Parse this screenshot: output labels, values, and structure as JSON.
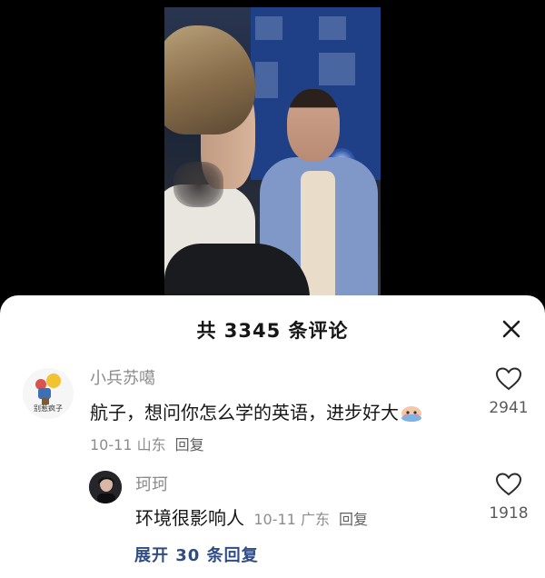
{
  "comments_header": {
    "title": "共 3345 条评论"
  },
  "comments": [
    {
      "username": "小兵苏噶",
      "avatar_caption": "别惹疯子",
      "text": "航子，想问你怎么学的英语，进步好大",
      "date_location": "10-11 山东",
      "reply_label": "回复",
      "likes": "2941"
    },
    {
      "username": "珂珂",
      "text": "环境很影响人",
      "date_location": "10-11 广东",
      "reply_label": "回复",
      "likes": "1918"
    }
  ],
  "expand_replies": {
    "label": "展开 30 条回复"
  },
  "icons": {
    "close": "close-icon",
    "like": "heart-outline-icon",
    "emoji": "blushing-face-emoji"
  },
  "colors": {
    "sheet_bg": "#ffffff",
    "text_primary": "#161616",
    "text_secondary": "#8c8c8c",
    "link": "#2f4c84"
  }
}
